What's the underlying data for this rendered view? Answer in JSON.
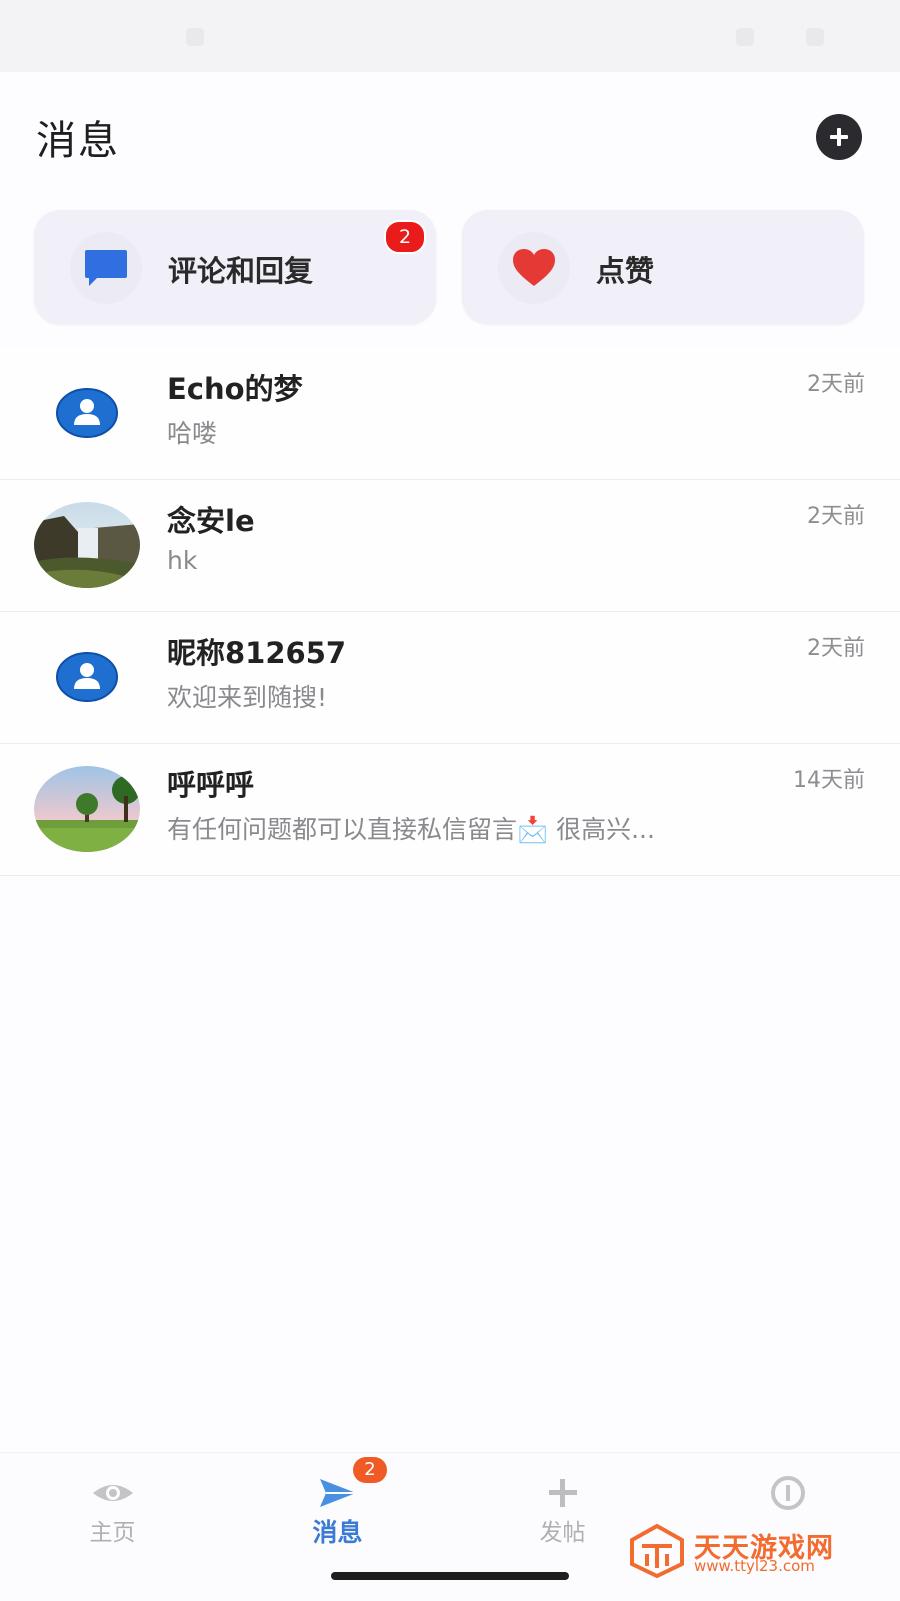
{
  "header": {
    "title": "消息"
  },
  "cards": [
    {
      "label": "评论和回复",
      "badge": "2",
      "icon": "comment-icon"
    },
    {
      "label": "点赞",
      "badge": "",
      "icon": "heart-icon"
    }
  ],
  "conversations": [
    {
      "name": "Echo的梦",
      "preview": "哈喽",
      "time": "2天前",
      "avatar": "default-user-icon"
    },
    {
      "name": "念安le",
      "preview": "hk",
      "time": "2天前",
      "avatar": "waterfall-photo"
    },
    {
      "name": "昵称812657",
      "preview": "欢迎来到随搜!",
      "time": "2天前",
      "avatar": "default-user-icon"
    },
    {
      "name": "呼呼呼",
      "preview": "有任何问题都可以直接私信留言📩 很高兴...",
      "time": "14天前",
      "avatar": "tree-landscape-photo"
    }
  ],
  "tabbar": {
    "items": [
      {
        "label": "主页",
        "icon": "eye-icon",
        "active": false
      },
      {
        "label": "消息",
        "icon": "send-icon",
        "active": true,
        "badge": "2"
      },
      {
        "label": "发帖",
        "icon": "plus-icon",
        "active": false
      },
      {
        "label": "",
        "icon": "info-icon",
        "active": false
      }
    ]
  },
  "watermark": {
    "title": "天天游戏网",
    "url": "www.ttyl23.com"
  },
  "colors": {
    "accent": "#3a7bd5",
    "badge_red": "#ea1b1b",
    "badge_orange": "#f05a24",
    "heart": "#e53935",
    "comment_blue": "#2f6fe0"
  }
}
